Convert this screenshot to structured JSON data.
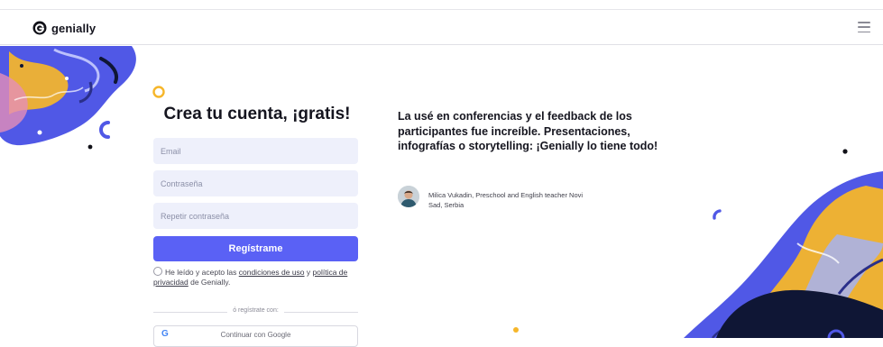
{
  "header": {
    "brand_name": "genially",
    "logo_icon": "genially-logo-icon",
    "menu_icon": "hamburger-menu-icon"
  },
  "signup": {
    "title": "Crea tu cuenta, ¡gratis!",
    "email_placeholder": "Email",
    "password_placeholder": "Contraseña",
    "repeat_password_placeholder": "Repetir contraseña",
    "register_button": "Regístrame",
    "terms": {
      "prefix": "He leído y acepto las ",
      "conditions_link": "condiciones de uso",
      "connector": " y ",
      "privacy_link": "política de privacidad",
      "suffix": " de Genially."
    },
    "divider_text": "ó regístrate con:",
    "google_button": "Continuar con Google",
    "google_icon": "google-g-icon"
  },
  "testimonial": {
    "quote": "La usé en conferencias y el feedback de los participantes fue increíble. Presentaciones, infografías o storytelling: ¡Genially lo tiene todo!",
    "author": "Milica Vukadin, Preschool and English teacher Novi Sad, Serbia"
  },
  "colors": {
    "primary": "#5a61f5",
    "blob_blue": "#5058e6",
    "blob_yellow": "#f6b62a",
    "dark_navy": "#0f1635",
    "input_bg": "#eef0fb"
  }
}
